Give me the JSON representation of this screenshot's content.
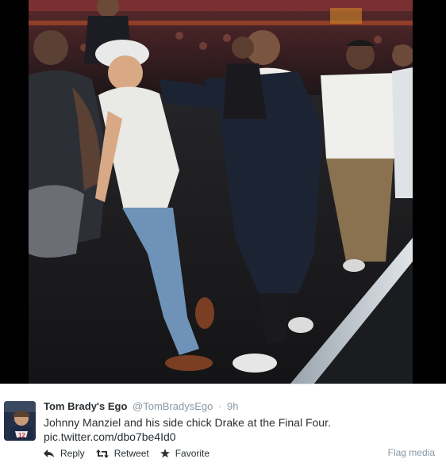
{
  "tweet": {
    "author_name": "Tom Brady's Ego",
    "author_handle": "@TomBradysEgo",
    "separator": "·",
    "timestamp": "9h",
    "text": "Johnny Manziel and his side chick Drake at the Final Four.",
    "link": "pic.twitter.com/dbo7be4Id0"
  },
  "actions": {
    "reply": "Reply",
    "retweet": "Retweet",
    "favorite": "Favorite",
    "flag": "Flag media"
  },
  "icons": {
    "reply": "reply-arrow-icon",
    "retweet": "retweet-icon",
    "favorite": "star-icon"
  },
  "colors": {
    "text": "#292f33",
    "muted": "#8899a6",
    "media_background": "#000000"
  }
}
